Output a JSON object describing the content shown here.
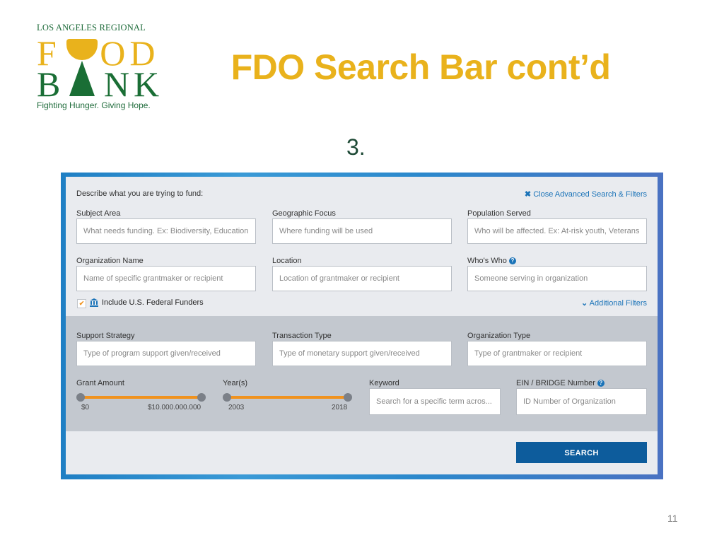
{
  "slide": {
    "title": "FDO Search Bar cont’d",
    "step": "3.",
    "page_number": "11"
  },
  "logo": {
    "top_line": "LOS ANGELES REGIONAL",
    "word1": "FOOD",
    "word2": "BANK",
    "tagline": "Fighting Hunger. Giving Hope.",
    "colors": {
      "gold": "#e9b21c",
      "green": "#1a6e35"
    }
  },
  "form": {
    "intro": "Describe what you are trying to fund:",
    "close_link": "Close Advanced Search & Filters",
    "additional_filters_link": "Additional Filters",
    "federal_funders": {
      "label": "Include U.S. Federal Funders",
      "checked": true
    },
    "fields": {
      "subject_area": {
        "label": "Subject Area",
        "placeholder": "What needs funding. Ex: Biodiversity, Education"
      },
      "geographic_focus": {
        "label": "Geographic Focus",
        "placeholder": "Where funding will be used"
      },
      "population_served": {
        "label": "Population Served",
        "placeholder": "Who will be affected. Ex: At-risk youth, Veterans"
      },
      "organization_name": {
        "label": "Organization Name",
        "placeholder": "Name of specific grantmaker or recipient"
      },
      "location": {
        "label": "Location",
        "placeholder": "Location of grantmaker or recipient"
      },
      "whos_who": {
        "label": "Who's Who",
        "placeholder": "Someone serving in organization"
      },
      "support_strategy": {
        "label": "Support Strategy",
        "placeholder": "Type of program support given/received"
      },
      "transaction_type": {
        "label": "Transaction Type",
        "placeholder": "Type of monetary support given/received"
      },
      "organization_type": {
        "label": "Organization Type",
        "placeholder": "Type of grantmaker or recipient"
      },
      "keyword": {
        "label": "Keyword",
        "placeholder": "Search for a specific term acros..."
      },
      "ein": {
        "label": "EIN / BRIDGE Number",
        "placeholder": "ID Number of Organization"
      }
    },
    "grant_amount": {
      "label": "Grant Amount",
      "min_label": "$0",
      "max_label": "$10.000.000.000",
      "selected_fraction": [
        0,
        1
      ]
    },
    "years": {
      "label": "Year(s)",
      "min_label": "2003",
      "max_label": "2018",
      "selected_fraction": [
        0,
        1
      ]
    },
    "search_button": "SEARCH",
    "colors": {
      "accent": "#0d5c9c",
      "link": "#1a73b8",
      "slider": "#f0921e"
    }
  }
}
